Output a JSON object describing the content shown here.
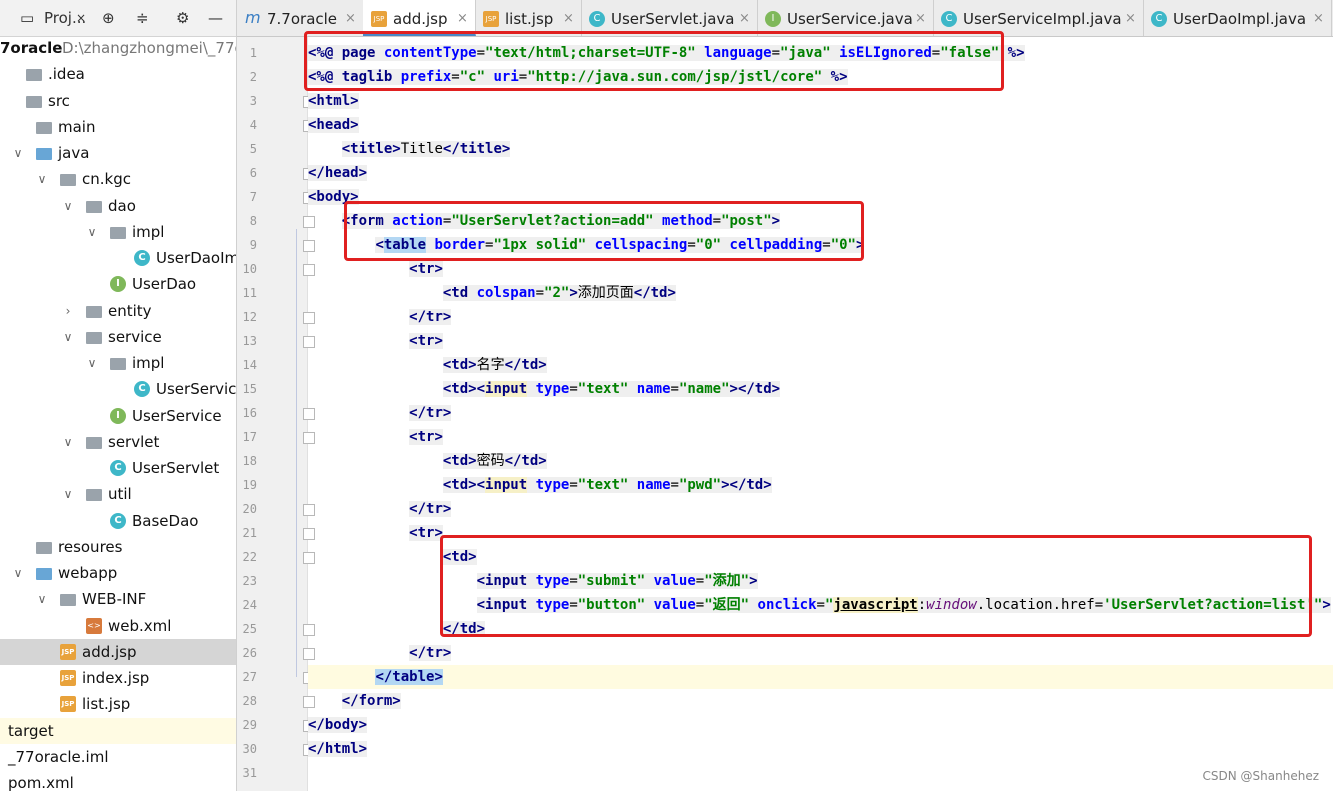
{
  "project_panel": {
    "toolbar": {
      "title": "Proj...",
      "close": "×"
    },
    "tree": [
      {
        "label": "7oracle",
        "path": "D:\\zhangzhongmei\\_77o",
        "level": 0,
        "type": "module"
      },
      {
        "label": ".idea",
        "level": 0,
        "type": "folder"
      },
      {
        "label": "src",
        "level": 0,
        "type": "folder"
      },
      {
        "label": "main",
        "level": 1,
        "type": "folder"
      },
      {
        "label": "java",
        "level": 1,
        "type": "folder-blue",
        "expanded": true
      },
      {
        "label": "cn.kgc",
        "level": 2,
        "type": "package",
        "expanded": true
      },
      {
        "label": "dao",
        "level": 3,
        "type": "package",
        "expanded": true
      },
      {
        "label": "impl",
        "level": 4,
        "type": "package",
        "expanded": true
      },
      {
        "label": "UserDaoIm",
        "level": 5,
        "type": "class"
      },
      {
        "label": "UserDao",
        "level": 4,
        "type": "interface"
      },
      {
        "label": "entity",
        "level": 3,
        "type": "package",
        "expanded": false
      },
      {
        "label": "service",
        "level": 3,
        "type": "package",
        "expanded": true
      },
      {
        "label": "impl",
        "level": 4,
        "type": "package",
        "expanded": true
      },
      {
        "label": "UserServic",
        "level": 5,
        "type": "class"
      },
      {
        "label": "UserService",
        "level": 4,
        "type": "interface"
      },
      {
        "label": "servlet",
        "level": 3,
        "type": "package",
        "expanded": true
      },
      {
        "label": "UserServlet",
        "level": 4,
        "type": "class"
      },
      {
        "label": "util",
        "level": 3,
        "type": "package",
        "expanded": true
      },
      {
        "label": "BaseDao",
        "level": 4,
        "type": "class"
      },
      {
        "label": "resoures",
        "level": 1,
        "type": "folder"
      },
      {
        "label": "webapp",
        "level": 1,
        "type": "folder-blue",
        "expanded": true
      },
      {
        "label": "WEB-INF",
        "level": 2,
        "type": "folder",
        "expanded": true
      },
      {
        "label": "web.xml",
        "level": 3,
        "type": "xml"
      },
      {
        "label": "add.jsp",
        "level": 2,
        "type": "jsp",
        "selected": true
      },
      {
        "label": "index.jsp",
        "level": 2,
        "type": "jsp"
      },
      {
        "label": "list.jsp",
        "level": 2,
        "type": "jsp"
      },
      {
        "label": "target",
        "level": 0,
        "type": "plain",
        "highlight": true
      },
      {
        "label": "_77oracle.iml",
        "level": 0,
        "type": "plain"
      },
      {
        "label": "pom.xml",
        "level": 0,
        "type": "plain"
      }
    ]
  },
  "tabs": [
    {
      "label": "7.7oracle",
      "icon": "m-icon",
      "active": false
    },
    {
      "label": "add.jsp",
      "icon": "jsp-icon",
      "active": true
    },
    {
      "label": "list.jsp",
      "icon": "jsp-icon",
      "active": false
    },
    {
      "label": "UserServlet.java",
      "icon": "class-icon",
      "active": false
    },
    {
      "label": "UserService.java",
      "icon": "interface-icon",
      "active": false
    },
    {
      "label": "UserServiceImpl.java",
      "icon": "class-icon",
      "active": false
    },
    {
      "label": "UserDaoImpl.java",
      "icon": "class-icon",
      "active": false
    }
  ],
  "editor": {
    "line_numbers": [
      "1",
      "2",
      "3",
      "4",
      "5",
      "6",
      "7",
      "8",
      "9",
      "10",
      "11",
      "12",
      "13",
      "14",
      "15",
      "16",
      "17",
      "18",
      "19",
      "20",
      "21",
      "22",
      "23",
      "24",
      "25",
      "26",
      "27",
      "28",
      "29",
      "30",
      "31"
    ],
    "current_line": 27
  },
  "watermark": "CSDN @Shanhehez"
}
